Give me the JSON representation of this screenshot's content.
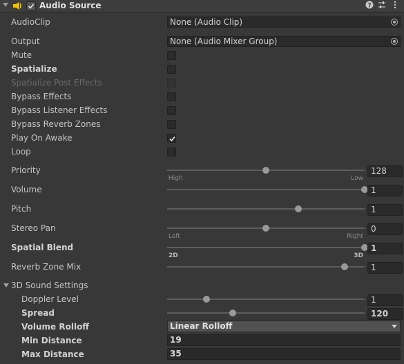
{
  "header": {
    "title": "Audio Source",
    "enabled": true
  },
  "fields": {
    "audio_clip": {
      "label": "AudioClip",
      "value": "None (Audio Clip)"
    },
    "output": {
      "label": "Output",
      "value": "None (Audio Mixer Group)"
    }
  },
  "toggles": [
    {
      "label": "Mute",
      "checked": false,
      "bold": false,
      "disabled": false
    },
    {
      "label": "Spatialize",
      "checked": false,
      "bold": true,
      "disabled": false
    },
    {
      "label": "Spatialize Post Effects",
      "checked": false,
      "bold": false,
      "disabled": true
    },
    {
      "label": "Bypass Effects",
      "checked": false,
      "bold": false,
      "disabled": false
    },
    {
      "label": "Bypass Listener Effects",
      "checked": false,
      "bold": false,
      "disabled": false
    },
    {
      "label": "Bypass Reverb Zones",
      "checked": false,
      "bold": false,
      "disabled": false
    },
    {
      "label": "Play On Awake",
      "checked": true,
      "bold": false,
      "disabled": false
    },
    {
      "label": "Loop",
      "checked": false,
      "bold": false,
      "disabled": false
    }
  ],
  "sliders": {
    "priority": {
      "label": "Priority",
      "value": "128",
      "fraction": 0.5,
      "min_label": "High",
      "max_label": "Low"
    },
    "volume": {
      "label": "Volume",
      "value": "1",
      "fraction": 1.0
    },
    "pitch": {
      "label": "Pitch",
      "value": "1",
      "fraction": 0.664
    },
    "stereo_pan": {
      "label": "Stereo Pan",
      "value": "0",
      "fraction": 0.5,
      "min_label": "Left",
      "max_label": "Right"
    },
    "spatial_blend": {
      "label": "Spatial Blend",
      "value": "1",
      "fraction": 1.0,
      "min_label": "2D",
      "max_label": "3D"
    },
    "reverb_zone_mix": {
      "label": "Reverb Zone Mix",
      "value": "1",
      "fraction": 0.9
    }
  },
  "sound3d": {
    "section_label": "3D Sound Settings",
    "doppler": {
      "label": "Doppler Level",
      "value": "1",
      "fraction": 0.2
    },
    "spread": {
      "label": "Spread",
      "value": "120",
      "fraction": 0.333
    },
    "volume_rolloff": {
      "label": "Volume Rolloff",
      "value": "Linear Rolloff"
    },
    "min_distance": {
      "label": "Min Distance",
      "value": "19"
    },
    "max_distance": {
      "label": "Max Distance",
      "value": "35"
    }
  },
  "colors": {
    "background": "#383838",
    "field": "#2a2a2a",
    "knob": "#999999"
  }
}
